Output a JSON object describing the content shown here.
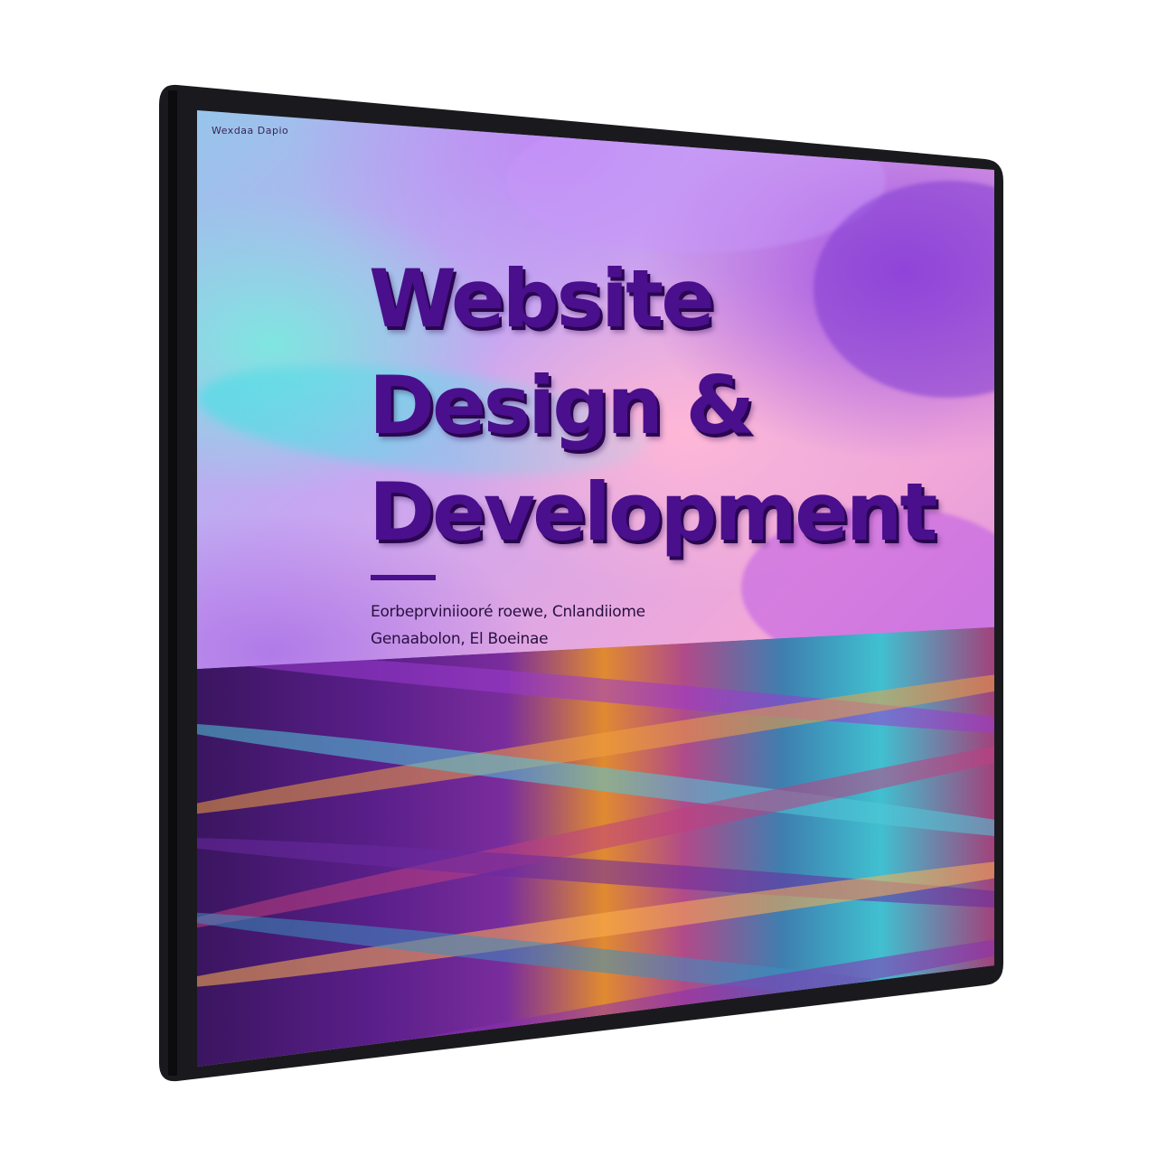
{
  "screen": {
    "brand": "Wexdaa Dapio",
    "headline": [
      "Website",
      "Design &",
      "Development"
    ],
    "subtitle": [
      "Eorbeprviniiooré roewe, Cnlandiiome",
      "Genaabolon, El Boeinae"
    ]
  },
  "colors": {
    "headline": "#4a0f8c",
    "bezel": "#1a1a1e",
    "accent_rule": "#4a0f8c"
  }
}
